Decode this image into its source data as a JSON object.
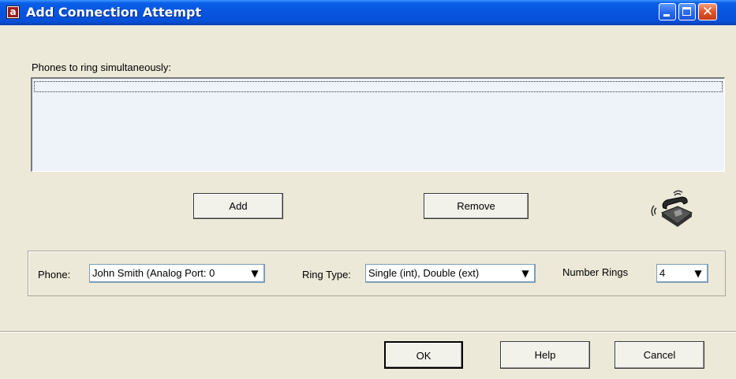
{
  "window": {
    "title": "Add Connection Attempt",
    "app_icon_letter": "a",
    "controls": [
      "minimize",
      "maximize",
      "close"
    ]
  },
  "phones_list": {
    "label": "Phones to ring simultaneously:",
    "items": []
  },
  "buttons": {
    "add": "Add",
    "remove": "Remove",
    "ok": "OK",
    "help": "Help",
    "cancel": "Cancel"
  },
  "settings": {
    "phone_label": "Phone:",
    "phone_value": "John Smith (Analog Port: 0",
    "ring_type_label": "Ring Type:",
    "ring_type_value": "Single (int), Double (ext)",
    "number_rings_label": "Number Rings",
    "number_rings_value": "4"
  },
  "icons": {
    "dropdown_arrow": "▼",
    "phone": "telephone-icon"
  }
}
